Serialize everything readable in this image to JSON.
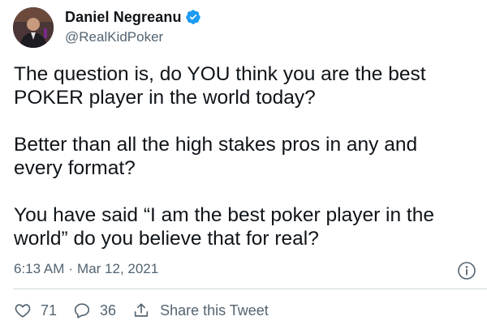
{
  "author": {
    "name": "Daniel Negreanu",
    "handle": "@RealKidPoker",
    "verified": true
  },
  "tweet": {
    "paragraphs": [
      "The question is, do YOU think you are the best POKER player in the world today?",
      "Better than all the high stakes pros in any and every format?",
      "You have said “I am the best poker player in the world” do you believe that for real?"
    ],
    "time": "6:13 AM",
    "separator": "·",
    "date": "Mar 12, 2021"
  },
  "actions": {
    "likes": "71",
    "replies": "36",
    "share_label": "Share this Tweet"
  },
  "colors": {
    "text": "#0f1419",
    "secondary": "#536471",
    "verified": "#1d9bf0",
    "divider": "#cfd9de"
  },
  "icons": [
    "verified-badge-icon",
    "info-icon",
    "heart-icon",
    "reply-icon",
    "share-icon"
  ]
}
